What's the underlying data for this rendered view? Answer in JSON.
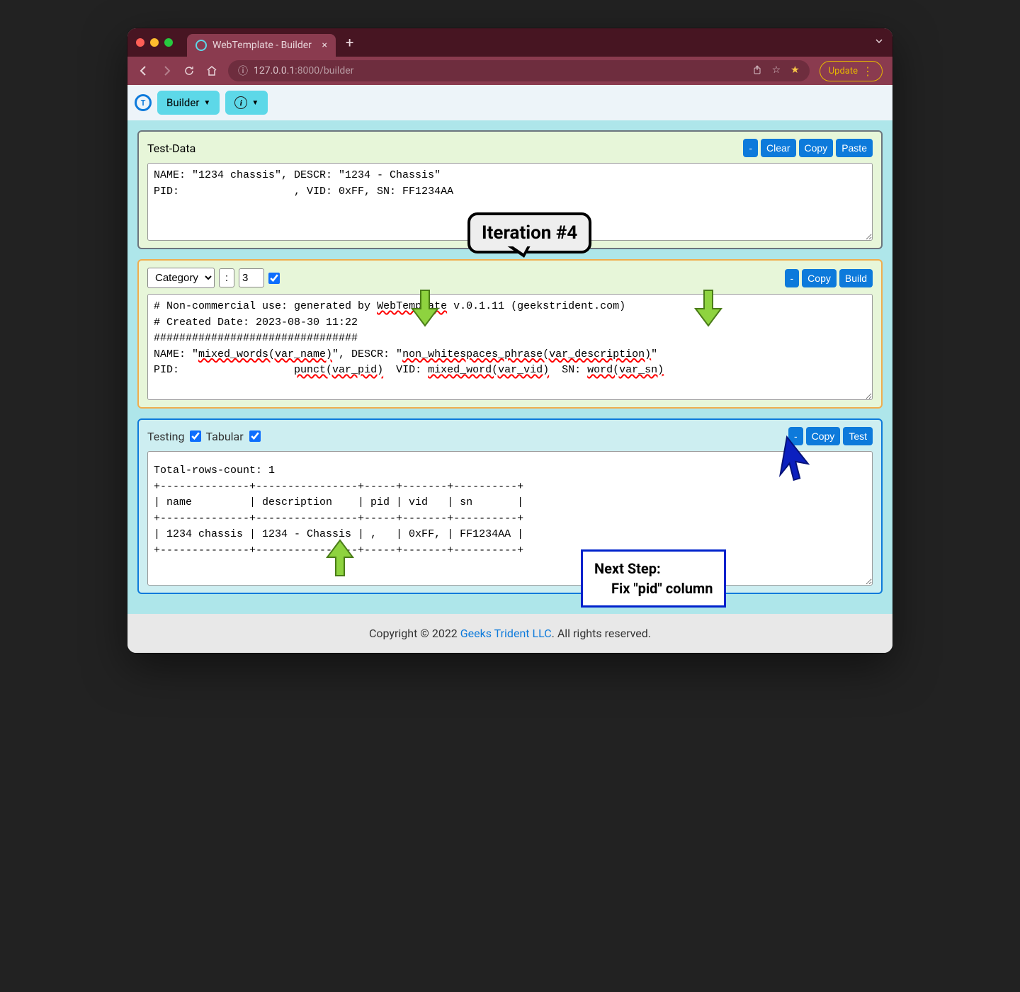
{
  "browser": {
    "tab_title": "WebTemplate - Builder",
    "url_host": "127.0.0.1",
    "url_port_path": ":8000/builder",
    "update_label": "Update"
  },
  "toolbar": {
    "builder_label": "Builder"
  },
  "panel_testdata": {
    "title": "Test-Data",
    "btn_minus": "-",
    "btn_clear": "Clear",
    "btn_copy": "Copy",
    "btn_paste": "Paste",
    "content": "NAME: \"1234 chassis\", DESCR: \"1234 - Chassis\"\nPID:                  , VID: 0xFF, SN: FF1234AA"
  },
  "panel_template": {
    "category_label": "Category",
    "separator": ":",
    "number": "3",
    "btn_minus": "-",
    "btn_copy": "Copy",
    "btn_build": "Build",
    "line1_a": "# Non-commercial use: generated by ",
    "line1_b": "WebTemplate",
    "line1_c": " v.0.1.11 (geekstrident.com)",
    "line2": "# Created Date: 2023-08-30 11:22",
    "line3": "################################",
    "line4_a": "NAME: \"",
    "line4_b": "mixed_words(var_name)",
    "line4_c": "\", DESCR: \"",
    "line4_d": "non_whitespaces_phrase(var_description)",
    "line4_e": "\"",
    "line5_a": "PID:                  ",
    "line5_b": "punct(var_pid)",
    "line5_c": "  VID: ",
    "line5_d": "mixed_word(var_vid)",
    "line5_e": "  SN: ",
    "line5_f": "word(var_sn)"
  },
  "panel_testing": {
    "testing_label": "Testing",
    "tabular_label": "Tabular",
    "btn_minus": "-",
    "btn_copy": "Copy",
    "btn_test": "Test",
    "content": "Total-rows-count: 1\n+--------------+----------------+-----+-------+----------+\n| name         | description    | pid | vid   | sn       |\n+--------------+----------------+-----+-------+----------+\n| 1234 chassis | 1234 - Chassis | ,   | 0xFF, | FF1234AA |\n+--------------+----------------+-----+-------+----------+"
  },
  "annotations": {
    "iteration": "Iteration #4",
    "next_line1": "Next Step:",
    "next_line2": "Fix \"pid\" column"
  },
  "footer": {
    "copyright_pre": "Copyright © 2022 ",
    "company": "Geeks Trident LLC",
    "copyright_post": ". All rights reserved."
  }
}
